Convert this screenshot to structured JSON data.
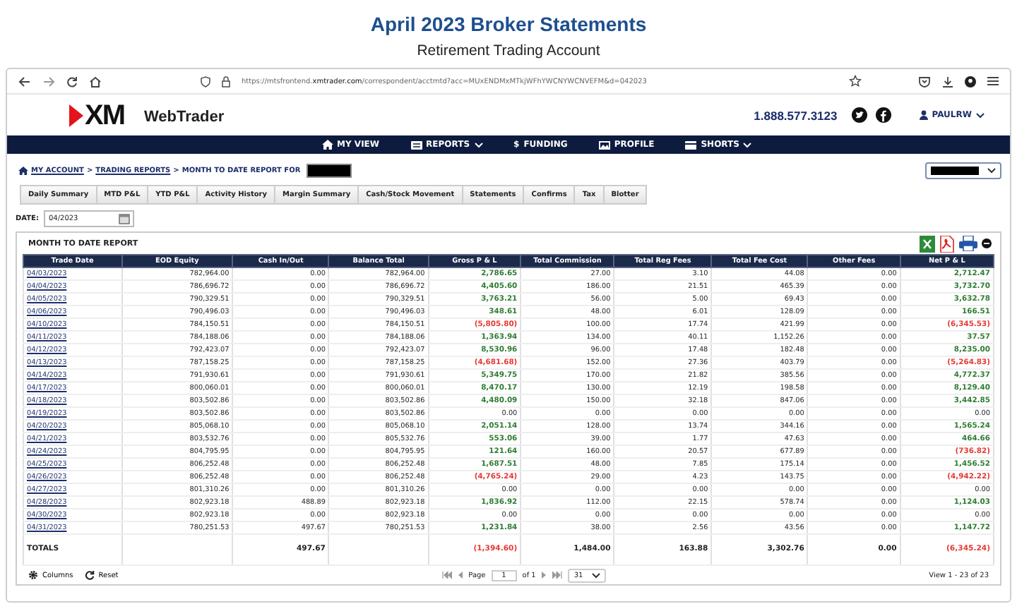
{
  "page_title": "April 2023 Broker Statements",
  "page_subtitle": "Retirement Trading Account",
  "browser": {
    "url": "https://mtsfrontend.**xmtrader.com**/correspondent/acctmtd?acc=MUxENDMxMTkjWFhYWCNYWCNVEFM&d=042023"
  },
  "site": {
    "logo": "XM",
    "brand": "WebTrader",
    "phone": "1.888.577.3123",
    "user": "PAULRW"
  },
  "nav": [
    {
      "kind": "home",
      "label": "MY VIEW",
      "dropdown": false
    },
    {
      "kind": "reports",
      "label": "REPORTS",
      "dropdown": true
    },
    {
      "kind": "funding",
      "glyph": "$",
      "label": "FUNDING",
      "dropdown": false
    },
    {
      "kind": "profile",
      "label": "PROFILE",
      "dropdown": false
    },
    {
      "kind": "shorts",
      "label": "SHORTS",
      "dropdown": true
    }
  ],
  "breadcrumb": [
    {
      "label": "MY ACCOUNT",
      "link": true
    },
    {
      "label": ">",
      "link": false
    },
    {
      "label": "TRADING REPORTS",
      "link": true
    },
    {
      "label": ">",
      "link": false
    },
    {
      "label": "MONTH TO DATE REPORT FOR",
      "link": false
    }
  ],
  "tabs": [
    "Daily Summary",
    "MTD P&L",
    "YTD P&L",
    "Activity History",
    "Margin Summary",
    "Cash/Stock Movement",
    "Statements",
    "Confirms",
    "Tax",
    "Blotter"
  ],
  "date_filter": {
    "label": "DATE:",
    "value": "04/2023"
  },
  "report": {
    "title": "MONTH TO DATE REPORT",
    "columns": [
      {
        "label": "Trade Date",
        "kind": "link"
      },
      {
        "label": "EOD Equity",
        "kind": "number"
      },
      {
        "label": "Cash In/Out",
        "kind": "number"
      },
      {
        "label": "Balance Total",
        "kind": "number"
      },
      {
        "label": "Gross P & L",
        "kind": "pl"
      },
      {
        "label": "Total Commission",
        "kind": "number"
      },
      {
        "label": "Total Reg Fees",
        "kind": "number"
      },
      {
        "label": "Total Fee Cost",
        "kind": "number"
      },
      {
        "label": "Other Fees",
        "kind": "number"
      },
      {
        "label": "Net P & L",
        "kind": "pl"
      }
    ],
    "rows": [
      [
        "04/03/2023",
        "782,964.00",
        "0.00",
        "782,964.00",
        {
          "text": "2,786.65",
          "color": "#2e7d32"
        },
        "27.00",
        "3.10",
        "44.08",
        "0.00",
        {
          "text": "2,712.47",
          "color": "#2e7d32"
        }
      ],
      [
        "04/04/2023",
        "786,696.72",
        "0.00",
        "786,696.72",
        {
          "text": "4,405.60",
          "color": "#2e7d32"
        },
        "186.00",
        "21.51",
        "465.39",
        "0.00",
        {
          "text": "3,732.70",
          "color": "#2e7d32"
        }
      ],
      [
        "04/05/2023",
        "790,329.51",
        "0.00",
        "790,329.51",
        {
          "text": "3,763.21",
          "color": "#2e7d32"
        },
        "56.00",
        "5.00",
        "69.43",
        "0.00",
        {
          "text": "3,632.78",
          "color": "#2e7d32"
        }
      ],
      [
        "04/06/2023",
        "790,496.03",
        "0.00",
        "790,496.03",
        {
          "text": "348.61",
          "color": "#2e7d32"
        },
        "48.00",
        "6.01",
        "128.09",
        "0.00",
        {
          "text": "166.51",
          "color": "#2e7d32"
        }
      ],
      [
        "04/10/2023",
        "784,150.51",
        "0.00",
        "784,150.51",
        {
          "text": "(5,805.80)",
          "color": "#e53935"
        },
        "100.00",
        "17.74",
        "421.99",
        "0.00",
        {
          "text": "(6,345.53)",
          "color": "#e53935"
        }
      ],
      [
        "04/11/2023",
        "784,188.06",
        "0.00",
        "784,188.06",
        {
          "text": "1,363.94",
          "color": "#2e7d32"
        },
        "134.00",
        "40.11",
        "1,152.26",
        "0.00",
        {
          "text": "37.57",
          "color": "#2e7d32"
        }
      ],
      [
        "04/12/2023",
        "792,423.07",
        "0.00",
        "792,423.07",
        {
          "text": "8,530.96",
          "color": "#2e7d32"
        },
        "96.00",
        "17.48",
        "182.48",
        "0.00",
        {
          "text": "8,235.00",
          "color": "#2e7d32"
        }
      ],
      [
        "04/13/2023",
        "787,158.25",
        "0.00",
        "787,158.25",
        {
          "text": "(4,681.68)",
          "color": "#e53935"
        },
        "152.00",
        "27.36",
        "403.79",
        "0.00",
        {
          "text": "(5,264.83)",
          "color": "#e53935"
        }
      ],
      [
        "04/14/2023",
        "791,930.61",
        "0.00",
        "791,930.61",
        {
          "text": "5,349.75",
          "color": "#2e7d32"
        },
        "170.00",
        "21.82",
        "385.56",
        "0.00",
        {
          "text": "4,772.37",
          "color": "#2e7d32"
        }
      ],
      [
        "04/17/2023",
        "800,060.01",
        "0.00",
        "800,060.01",
        {
          "text": "8,470.17",
          "color": "#2e7d32"
        },
        "130.00",
        "12.19",
        "198.58",
        "0.00",
        {
          "text": "8,129.40",
          "color": "#2e7d32"
        }
      ],
      [
        "04/18/2023",
        "803,502.86",
        "0.00",
        "803,502.86",
        {
          "text": "4,480.09",
          "color": "#2e7d32"
        },
        "150.00",
        "32.18",
        "847.06",
        "0.00",
        {
          "text": "3,442.85",
          "color": "#2e7d32"
        }
      ],
      [
        "04/19/2023",
        "803,502.86",
        "0.00",
        "803,502.86",
        "0.00",
        "0.00",
        "0.00",
        "0.00",
        "0.00",
        "0.00"
      ],
      [
        "04/20/2023",
        "805,068.10",
        "0.00",
        "805,068.10",
        {
          "text": "2,051.14",
          "color": "#2e7d32"
        },
        "128.00",
        "13.74",
        "344.16",
        "0.00",
        {
          "text": "1,565.24",
          "color": "#2e7d32"
        }
      ],
      [
        "04/21/2023",
        "803,532.76",
        "0.00",
        "805,532.76",
        {
          "text": "553.06",
          "color": "#2e7d32"
        },
        "39.00",
        "1.77",
        "47.63",
        "0.00",
        {
          "text": "464.66",
          "color": "#2e7d32"
        }
      ],
      [
        "04/24/2023",
        "804,795.95",
        "0.00",
        "804,795.95",
        {
          "text": "121.64",
          "color": "#2e7d32"
        },
        "160.00",
        "20.57",
        "677.89",
        "0.00",
        {
          "text": "(736.82)",
          "color": "#e53935"
        }
      ],
      [
        "04/25/2023",
        "806,252.48",
        "0.00",
        "806,252.48",
        {
          "text": "1,687.51",
          "color": "#2e7d32"
        },
        "48.00",
        "7.85",
        "175.14",
        "0.00",
        {
          "text": "1,456.52",
          "color": "#2e7d32"
        }
      ],
      [
        "04/26/2023",
        "806,252.48",
        "0.00",
        "806,252.48",
        {
          "text": "(4,765.24)",
          "color": "#e53935"
        },
        "29.00",
        "4.23",
        "143.75",
        "0.00",
        {
          "text": "(4,942.22)",
          "color": "#e53935"
        }
      ],
      [
        "04/27/2023",
        "801,310.26",
        "0.00",
        "801,310.26",
        "0.00",
        "0.00",
        "0.00",
        "0.00",
        "0.00",
        "0.00"
      ],
      [
        "04/28/2023",
        "802,923.18",
        "488.89",
        "802,923.18",
        {
          "text": "1,836.92",
          "color": "#2e7d32"
        },
        "112.00",
        "22.15",
        "578.74",
        "0.00",
        {
          "text": "1,124.03",
          "color": "#2e7d32"
        }
      ],
      [
        "04/30/2023",
        "802,923.18",
        "0.00",
        "802,923.18",
        "0.00",
        "0.00",
        "0.00",
        "0.00",
        "0.00",
        "0.00"
      ],
      [
        "04/31/2023",
        "780,251.53",
        "497.67",
        "780,251.53",
        {
          "text": "1,231.84",
          "color": "#2e7d32"
        },
        "38.00",
        "2.56",
        "43.56",
        "0.00",
        {
          "text": "1,147.72",
          "color": "#2e7d32"
        }
      ]
    ],
    "totals": {
      "label": "TOTALS",
      "cash_in_out": "497.67",
      "gross_pl": {
        "text": "(1,394.60)",
        "color": "#e53935"
      },
      "total_commission": "1,484.00",
      "total_reg_fees": "163.88",
      "total_fee_cost": "3,302.76",
      "other_fees": "0.00",
      "net_pl": {
        "text": "(6,345.24)",
        "color": "#e53935"
      }
    }
  },
  "footer": {
    "columns_button": "Columns",
    "reset_button": "Reset",
    "page_label": "Page",
    "page_value": "1",
    "page_of": "of 1",
    "page_size": "31",
    "view_text": "View 1 - 23 of 23"
  }
}
